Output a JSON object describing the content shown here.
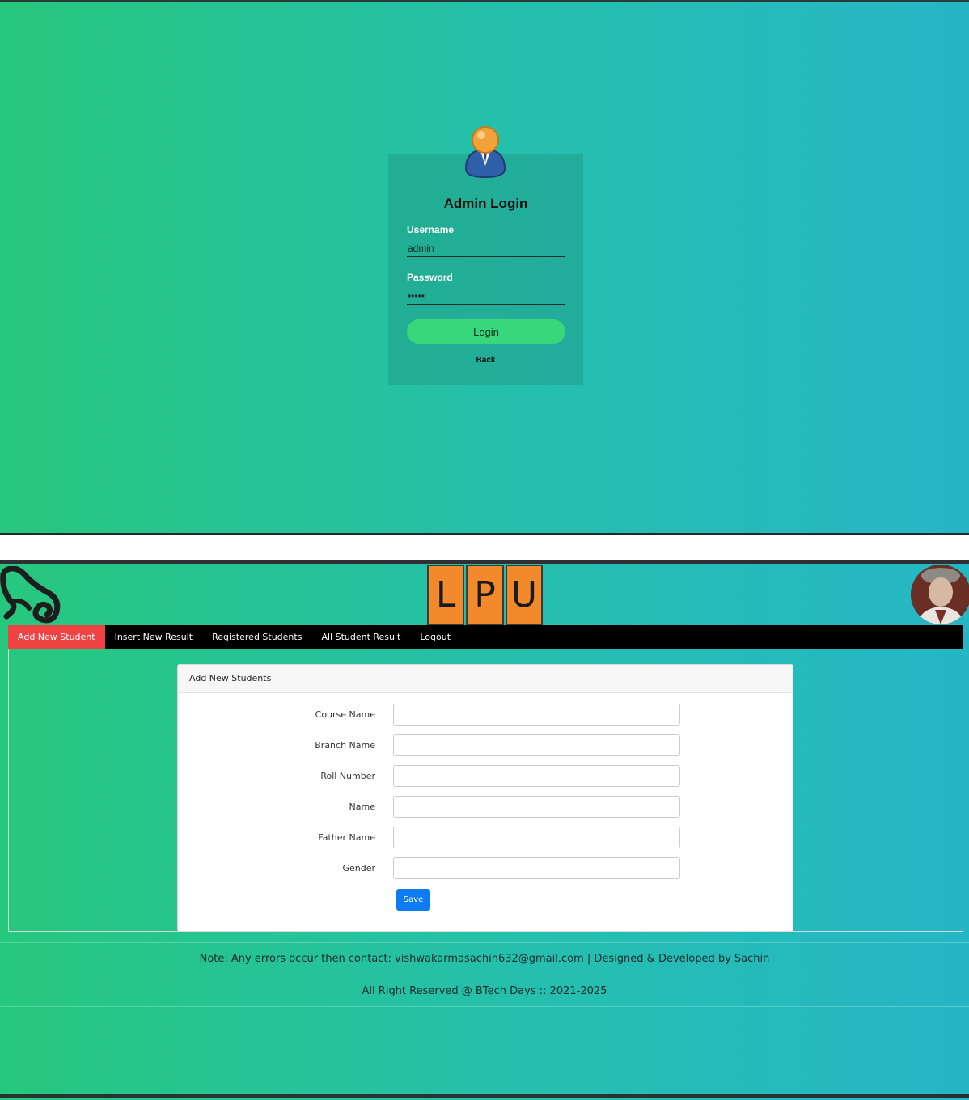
{
  "login": {
    "title": "Admin Login",
    "username_label": "Username",
    "username_value": "admin",
    "password_label": "Password",
    "password_value": "•••••",
    "login_button": "Login",
    "back_link": "Back"
  },
  "header": {
    "logo_letters": [
      "L",
      "P",
      "U"
    ]
  },
  "nav": {
    "items": [
      {
        "label": "Add New Student",
        "active": true
      },
      {
        "label": "Insert New Result",
        "active": false
      },
      {
        "label": "Registered Students",
        "active": false
      },
      {
        "label": "All Student Result",
        "active": false
      },
      {
        "label": "Logout",
        "active": false
      }
    ]
  },
  "form": {
    "title": "Add New Students",
    "fields": [
      {
        "label": "Course Name",
        "value": ""
      },
      {
        "label": "Branch Name",
        "value": ""
      },
      {
        "label": "Roll Number",
        "value": ""
      },
      {
        "label": "Name",
        "value": ""
      },
      {
        "label": "Father Name",
        "value": ""
      },
      {
        "label": "Gender",
        "value": ""
      }
    ],
    "save_button": "Save"
  },
  "footer": {
    "note": "Note: Any errors occur then contact: vishwakarmasachin632@gmail.com | Designed & Developed by Sachin",
    "rights": "All Right Reserved @ BTech Days :: 2021-2025"
  },
  "colors": {
    "gradient_start": "#26c77d",
    "gradient_end": "#25b6c6",
    "nav_active": "#f04444",
    "login_button": "#38d77b",
    "save_button": "#0d7bf2",
    "logo_tile": "#f2892a"
  }
}
